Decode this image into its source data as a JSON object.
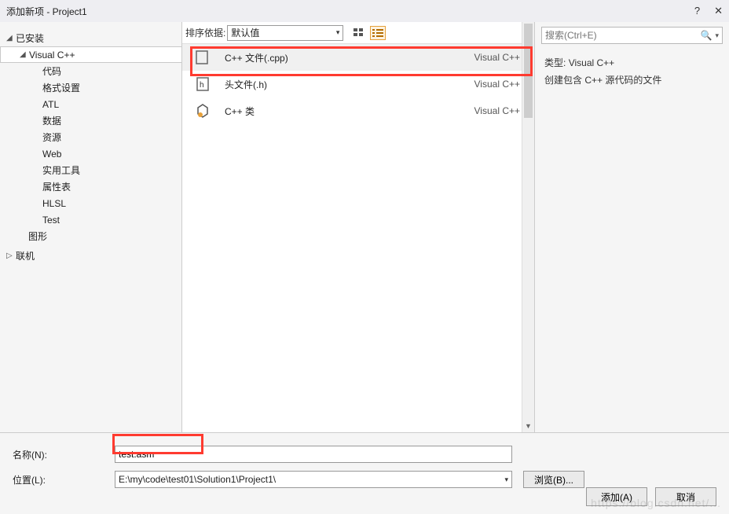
{
  "title": "添加新项 - Project1",
  "sidebar": {
    "installed": "已安装",
    "visual_cpp": "Visual C++",
    "items": [
      "代码",
      "格式设置",
      "ATL",
      "数据",
      "资源",
      "Web",
      "实用工具",
      "属性表",
      "HLSL",
      "Test"
    ],
    "graphics": "图形",
    "online": "联机"
  },
  "top": {
    "sort_label": "排序依据:",
    "sort_value": "默认值",
    "search_placeholder": "搜索(Ctrl+E)"
  },
  "templates": [
    {
      "name": "C++ 文件(.cpp)",
      "lang": "Visual C++",
      "selected": true
    },
    {
      "name": "头文件(.h)",
      "lang": "Visual C++",
      "selected": false
    },
    {
      "name": "C++ 类",
      "lang": "Visual C++",
      "selected": false
    }
  ],
  "details": {
    "type_label": "类型:",
    "type_value": "Visual C++",
    "desc": "创建包含 C++ 源代码的文件"
  },
  "form": {
    "name_label": "名称(N):",
    "name_value": "test.asm",
    "loc_label": "位置(L):",
    "loc_value": "E:\\my\\code\\test01\\Solution1\\Project1\\",
    "browse": "浏览(B)...",
    "add": "添加(A)",
    "cancel": "取消"
  }
}
